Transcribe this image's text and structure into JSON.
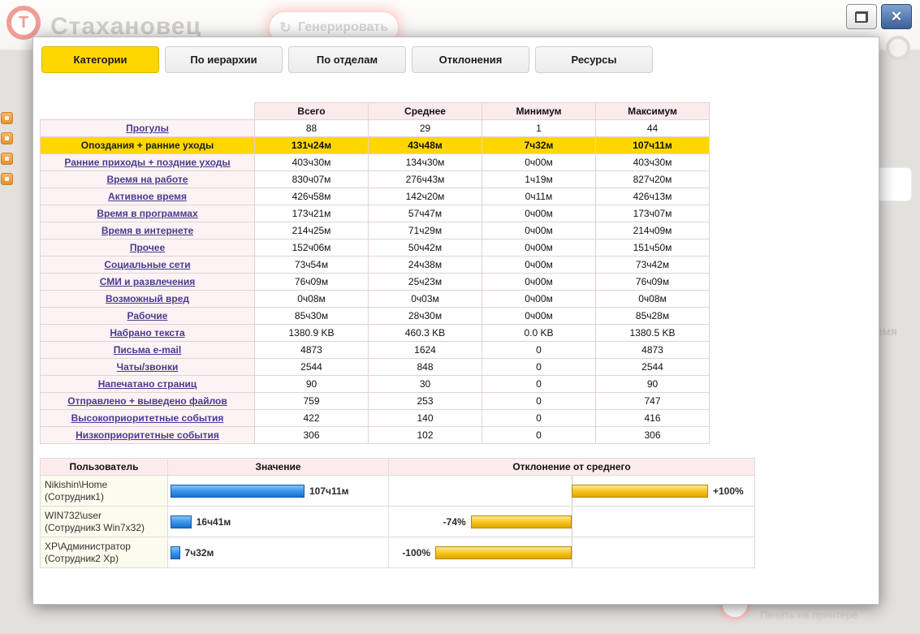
{
  "colors": {
    "accent_gold": "#ffd700",
    "link_purple": "#4a3b8f",
    "header_pink": "#fcebed",
    "value_bar_blue": "#3f9af0",
    "deviation_bar_gold": "#f6c21a"
  },
  "background": {
    "app_title": "Стахановец",
    "generate_button": "Генерировать",
    "print_label": "Печать на принтере",
    "side_fragment": "время"
  },
  "window_controls": {
    "close_glyph": "✕"
  },
  "tabs": [
    {
      "id": "categories",
      "label": "Категории",
      "active": true
    },
    {
      "id": "hierarchy",
      "label": "По иерархии",
      "active": false
    },
    {
      "id": "departments",
      "label": "По отделам",
      "active": false
    },
    {
      "id": "deviations",
      "label": "Отклонения",
      "active": false
    },
    {
      "id": "resources",
      "label": "Ресурсы",
      "active": false
    }
  ],
  "stats_table": {
    "headers": [
      "",
      "Всего",
      "Среднее",
      "Минимум",
      "Максимум"
    ],
    "rows": [
      {
        "label": "Прогулы",
        "values": [
          "88",
          "29",
          "1",
          "44"
        ],
        "highlight": false
      },
      {
        "label": "Опоздания + ранние уходы",
        "values": [
          "131ч24м",
          "43ч48м",
          "7ч32м",
          "107ч11м"
        ],
        "highlight": true
      },
      {
        "label": "Ранние приходы + поздние уходы",
        "values": [
          "403ч30м",
          "134ч30м",
          "0ч00м",
          "403ч30м"
        ],
        "highlight": false
      },
      {
        "label": "Время на работе",
        "values": [
          "830ч07м",
          "276ч43м",
          "1ч19м",
          "827ч20м"
        ],
        "highlight": false
      },
      {
        "label": "Активное время",
        "values": [
          "426ч58м",
          "142ч20м",
          "0ч11м",
          "426ч13м"
        ],
        "highlight": false
      },
      {
        "label": "Время в программах",
        "values": [
          "173ч21м",
          "57ч47м",
          "0ч00м",
          "173ч07м"
        ],
        "highlight": false
      },
      {
        "label": "Время в интернете",
        "values": [
          "214ч25м",
          "71ч29м",
          "0ч00м",
          "214ч09м"
        ],
        "highlight": false
      },
      {
        "label": "Прочее",
        "values": [
          "152ч06м",
          "50ч42м",
          "0ч00м",
          "151ч50м"
        ],
        "highlight": false
      },
      {
        "label": "Социальные сети",
        "values": [
          "73ч54м",
          "24ч38м",
          "0ч00м",
          "73ч42м"
        ],
        "highlight": false
      },
      {
        "label": "СМИ и развлечения",
        "values": [
          "76ч09м",
          "25ч23м",
          "0ч00м",
          "76ч09м"
        ],
        "highlight": false
      },
      {
        "label": "Возможный вред",
        "values": [
          "0ч08м",
          "0ч03м",
          "0ч00м",
          "0ч08м"
        ],
        "highlight": false
      },
      {
        "label": "Рабочие",
        "values": [
          "85ч30м",
          "28ч30м",
          "0ч00м",
          "85ч28м"
        ],
        "highlight": false
      },
      {
        "label": "Набрано текста",
        "values": [
          "1380.9 KB",
          "460.3 KB",
          "0.0 KB",
          "1380.5 KB"
        ],
        "highlight": false
      },
      {
        "label": "Письма e-mail",
        "values": [
          "4873",
          "1624",
          "0",
          "4873"
        ],
        "highlight": false
      },
      {
        "label": "Чаты/звонки",
        "values": [
          "2544",
          "848",
          "0",
          "2544"
        ],
        "highlight": false
      },
      {
        "label": "Напечатано страниц",
        "values": [
          "90",
          "30",
          "0",
          "90"
        ],
        "highlight": false
      },
      {
        "label": "Отправлено + выведено файлов",
        "values": [
          "759",
          "253",
          "0",
          "747"
        ],
        "highlight": false
      },
      {
        "label": "Высокоприоритетные события",
        "values": [
          "422",
          "140",
          "0",
          "416"
        ],
        "highlight": false
      },
      {
        "label": "Низкоприоритетные события",
        "values": [
          "306",
          "102",
          "0",
          "306"
        ],
        "highlight": false
      }
    ]
  },
  "users_table": {
    "headers": [
      "Пользователь",
      "Значение",
      "Отклонение от среднего"
    ],
    "rows": [
      {
        "name": "Nikishin\\Home",
        "alias": "(Сотрудник1)",
        "value": "107ч11м",
        "value_bar_pct": 100,
        "deviation_label": "+100%",
        "deviation_pct": 100
      },
      {
        "name": "WIN732\\user",
        "alias": "(Сотрудник3 Win7x32)",
        "value": "16ч41м",
        "value_bar_pct": 15.6,
        "deviation_label": "-74%",
        "deviation_pct": -74
      },
      {
        "name": "XP\\Администратор",
        "alias": "(Сотрудник2 Хр)",
        "value": "7ч32м",
        "value_bar_pct": 7,
        "deviation_label": "-100%",
        "deviation_pct": -100
      }
    ]
  }
}
